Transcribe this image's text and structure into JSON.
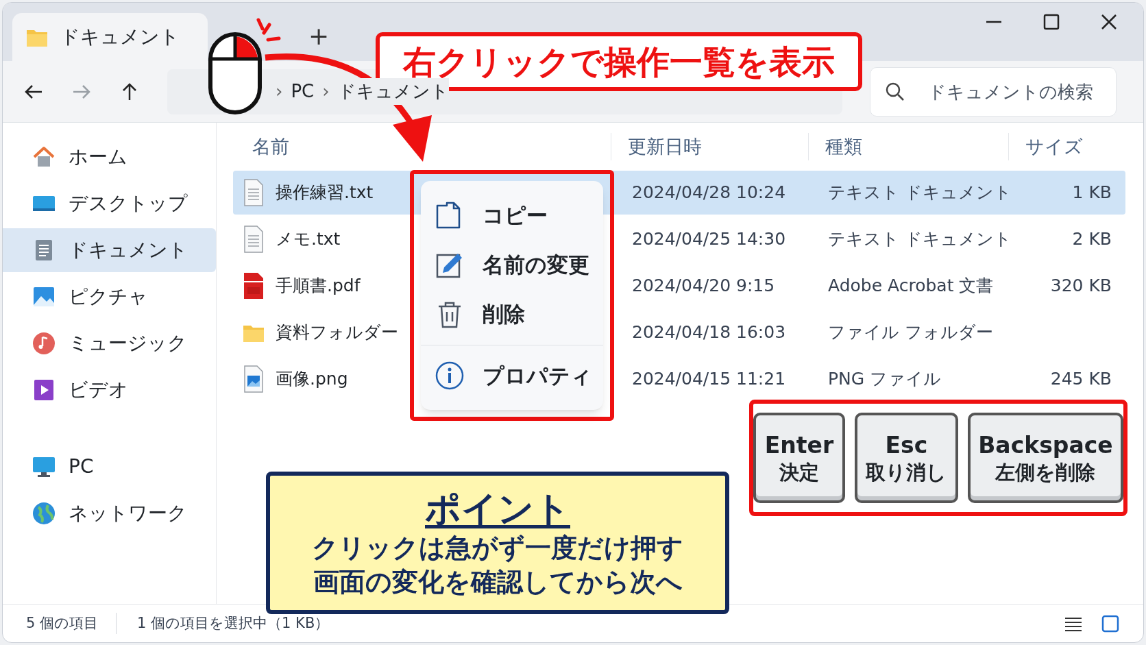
{
  "window": {
    "tab_title": "ドキュメント",
    "new_tab": "+"
  },
  "breadcrumb": {
    "separator": "›",
    "items": [
      "PC",
      "ドキュメント"
    ]
  },
  "search": {
    "placeholder": "ドキュメントの検索"
  },
  "sidebar": {
    "sections": [
      {
        "items": [
          {
            "label": "ホーム",
            "kind": "home",
            "selected": false
          },
          {
            "label": "デスクトップ",
            "kind": "desktop",
            "selected": false
          },
          {
            "label": "ドキュメント",
            "kind": "documents",
            "selected": true
          },
          {
            "label": "ピクチャ",
            "kind": "pictures",
            "selected": false
          },
          {
            "label": "ミュージック",
            "kind": "music",
            "selected": false
          },
          {
            "label": "ビデオ",
            "kind": "video",
            "selected": false
          }
        ]
      },
      {
        "items": [
          {
            "label": "PC",
            "kind": "pc",
            "selected": false
          },
          {
            "label": "ネットワーク",
            "kind": "network",
            "selected": false
          }
        ]
      }
    ]
  },
  "table": {
    "columns": [
      "名前",
      "更新日時",
      "種類",
      "サイズ"
    ],
    "rows": [
      {
        "name": "操作練習.txt",
        "kind": "text",
        "modified": "2024/04/28 10:24",
        "type": "テキスト ドキュメント",
        "size": "1 KB",
        "selected": true
      },
      {
        "name": "メモ.txt",
        "kind": "text",
        "modified": "2024/04/25 14:30",
        "type": "テキスト ドキュメント",
        "size": "2 KB",
        "selected": false
      },
      {
        "name": "手順書.pdf",
        "kind": "pdf",
        "modified": "2024/04/20 9:15",
        "type": "Adobe Acrobat 文書",
        "size": "320 KB",
        "selected": false
      },
      {
        "name": "資料フォルダー",
        "kind": "folder",
        "modified": "2024/04/18 16:03",
        "type": "ファイル フォルダー",
        "selected": false
      },
      {
        "name": "画像.png",
        "kind": "image",
        "modified": "2024/04/15 11:21",
        "type": "PNG ファイル",
        "size": "245 KB",
        "selected": false
      }
    ]
  },
  "context_menu": {
    "items": [
      {
        "label": "コピー",
        "kind": "copy",
        "separator_before": false
      },
      {
        "label": "名前の変更",
        "kind": "rename",
        "separator_before": false
      },
      {
        "label": "削除",
        "kind": "delete",
        "separator_before": false
      },
      {
        "label": "プロパティ",
        "kind": "properties",
        "separator_before": true
      }
    ]
  },
  "callout": "右クリックで操作一覧を表示",
  "keys": [
    {
      "key": "Enter",
      "action": "決定"
    },
    {
      "key": "Esc",
      "action": "取り消し"
    },
    {
      "key": "Backspace",
      "action": "左側を削除"
    }
  ],
  "tip": {
    "title": "ポイント",
    "lines": [
      "クリックは急がず一度だけ押す",
      "画面の変化を確認してから次へ"
    ]
  },
  "status_bar": {
    "item_count": "5 個の項目",
    "selection": "1 個の項目を選択中（1 KB）"
  },
  "view_buttons": [
    {
      "kind": "details",
      "selected": false
    },
    {
      "kind": "tiles",
      "selected": true
    }
  ]
}
